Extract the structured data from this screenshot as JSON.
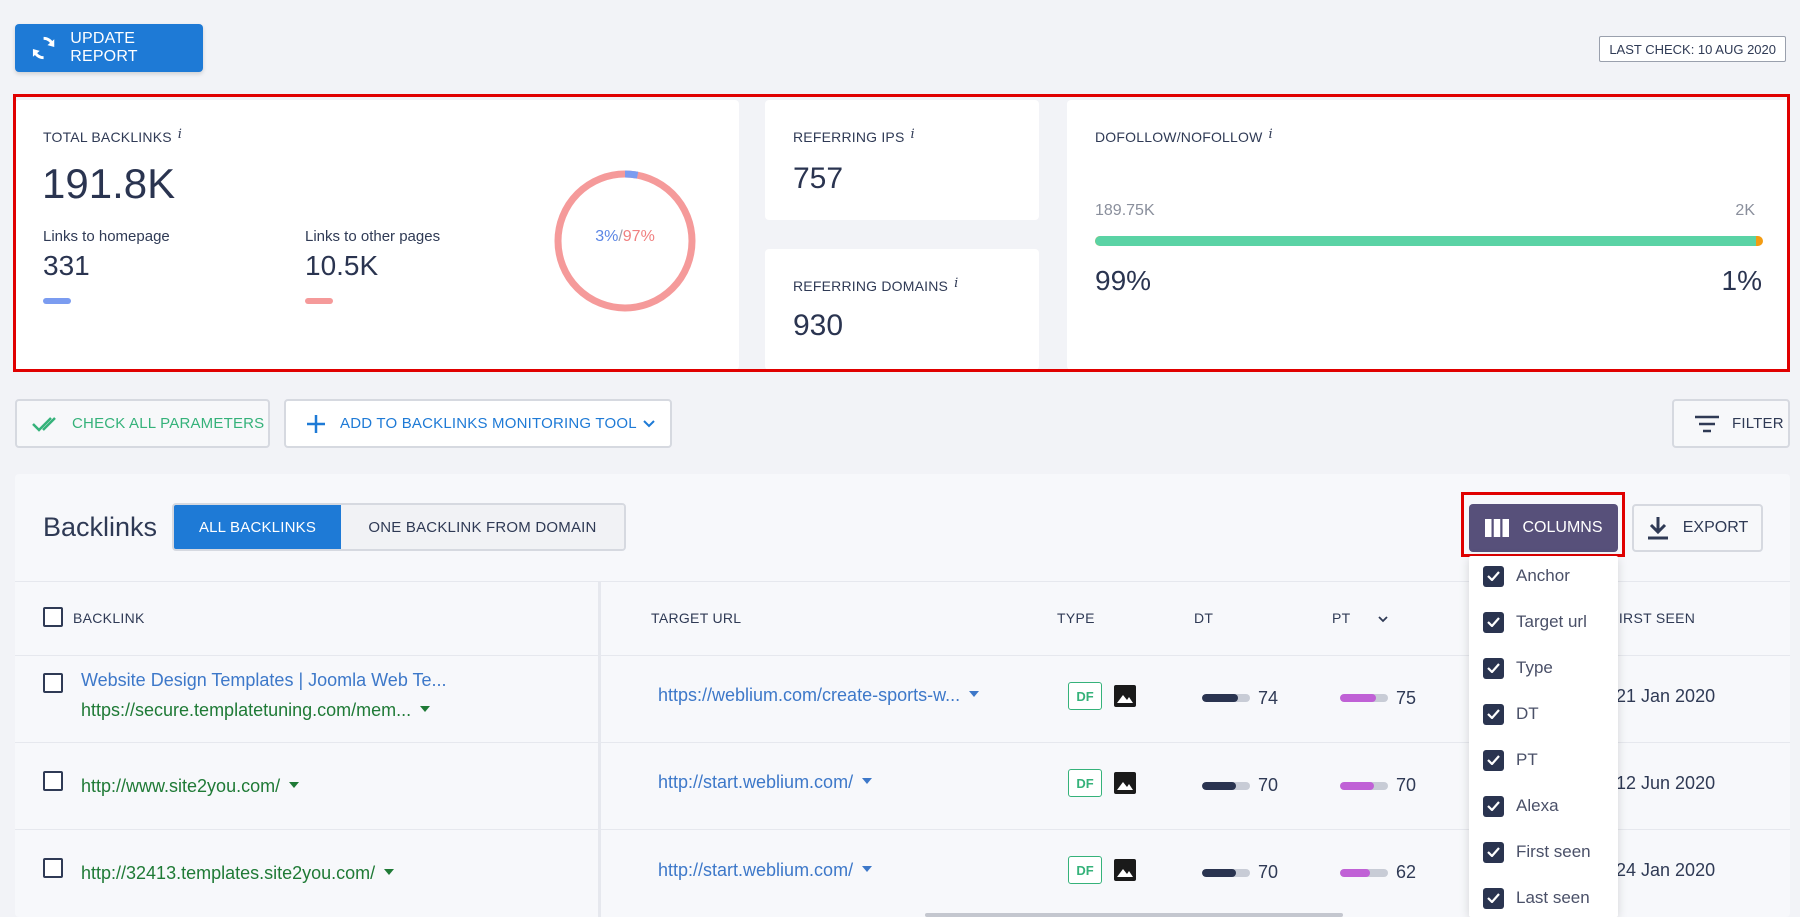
{
  "header": {
    "update_label": "UPDATE REPORT",
    "last_check": "LAST CHECK: 10 AUG 2020"
  },
  "total_backlinks": {
    "label": "TOTAL BACKLINKS",
    "info": "i",
    "value": "191.8K",
    "homepage_label": "Links to homepage",
    "homepage_value": "331",
    "other_label": "Links to other pages",
    "other_value": "10.5K",
    "donut_homepage_pct": "3%",
    "donut_sep": "/",
    "donut_other_pct": "97%",
    "homepage_fraction": 0.03,
    "homepage_color": "#7b9cf0",
    "other_color": "#f59a9a"
  },
  "referring_ips": {
    "label": "REFERRING IPS",
    "info": "i",
    "value": "757"
  },
  "referring_domains": {
    "label": "REFERRING DOMAINS",
    "info": "i",
    "value": "930"
  },
  "dofollow": {
    "label": "DOFOLLOW/NOFOLLOW",
    "info": "i",
    "dofollow_count": "189.75K",
    "nofollow_count": "2K",
    "dofollow_pct": "99%",
    "nofollow_pct": "1%",
    "dofollow_fraction": 0.99,
    "dofollow_color": "#5ad3a5",
    "nofollow_color": "#f39c12"
  },
  "actions": {
    "check_all_label": "CHECK ALL PARAMETERS",
    "add_monitoring_label": "ADD TO BACKLINKS MONITORING TOOL",
    "filter_label": "FILTER"
  },
  "backlinks": {
    "title": "Backlinks",
    "tab_all": "ALL BACKLINKS",
    "tab_one": "ONE BACKLINK FROM DOMAIN",
    "columns_label": "COLUMNS",
    "export_label": "EXPORT"
  },
  "table": {
    "headers": {
      "backlink": "BACKLINK",
      "target_url": "TARGET URL",
      "type": "TYPE",
      "dt": "DT",
      "pt": "PT",
      "first_seen": "FIRST SEEN"
    },
    "rows": [
      {
        "title": "Website Design Templates | Joomla Web Te...",
        "source": "https://secure.templatetuning.com/mem...",
        "target": "https://weblium.com/create-sports-w...",
        "type": "DF",
        "dt": "74",
        "dt_fraction": 0.74,
        "pt": "75",
        "pt_fraction": 0.75,
        "first_seen": "21 Jan 2020"
      },
      {
        "title": "",
        "source": "http://www.site2you.com/",
        "target": "http://start.weblium.com/",
        "type": "DF",
        "dt": "70",
        "dt_fraction": 0.7,
        "pt": "70",
        "pt_fraction": 0.7,
        "first_seen": "12 Jun 2020"
      },
      {
        "title": "",
        "source": "http://32413.templates.site2you.com/",
        "target": "http://start.weblium.com/",
        "type": "DF",
        "dt": "70",
        "dt_fraction": 0.7,
        "pt": "62",
        "pt_fraction": 0.62,
        "first_seen": "24 Jan 2020"
      }
    ]
  },
  "columns_menu": {
    "items": [
      "Anchor",
      "Target url",
      "Type",
      "DT",
      "PT",
      "Alexa",
      "First seen",
      "Last seen"
    ]
  },
  "colors": {
    "primary": "#1e7ad6",
    "columns_button": "#57507a",
    "dt_meter": "#2a3450",
    "pt_meter": "#c061d6",
    "highlight_frame": "#e00000"
  }
}
